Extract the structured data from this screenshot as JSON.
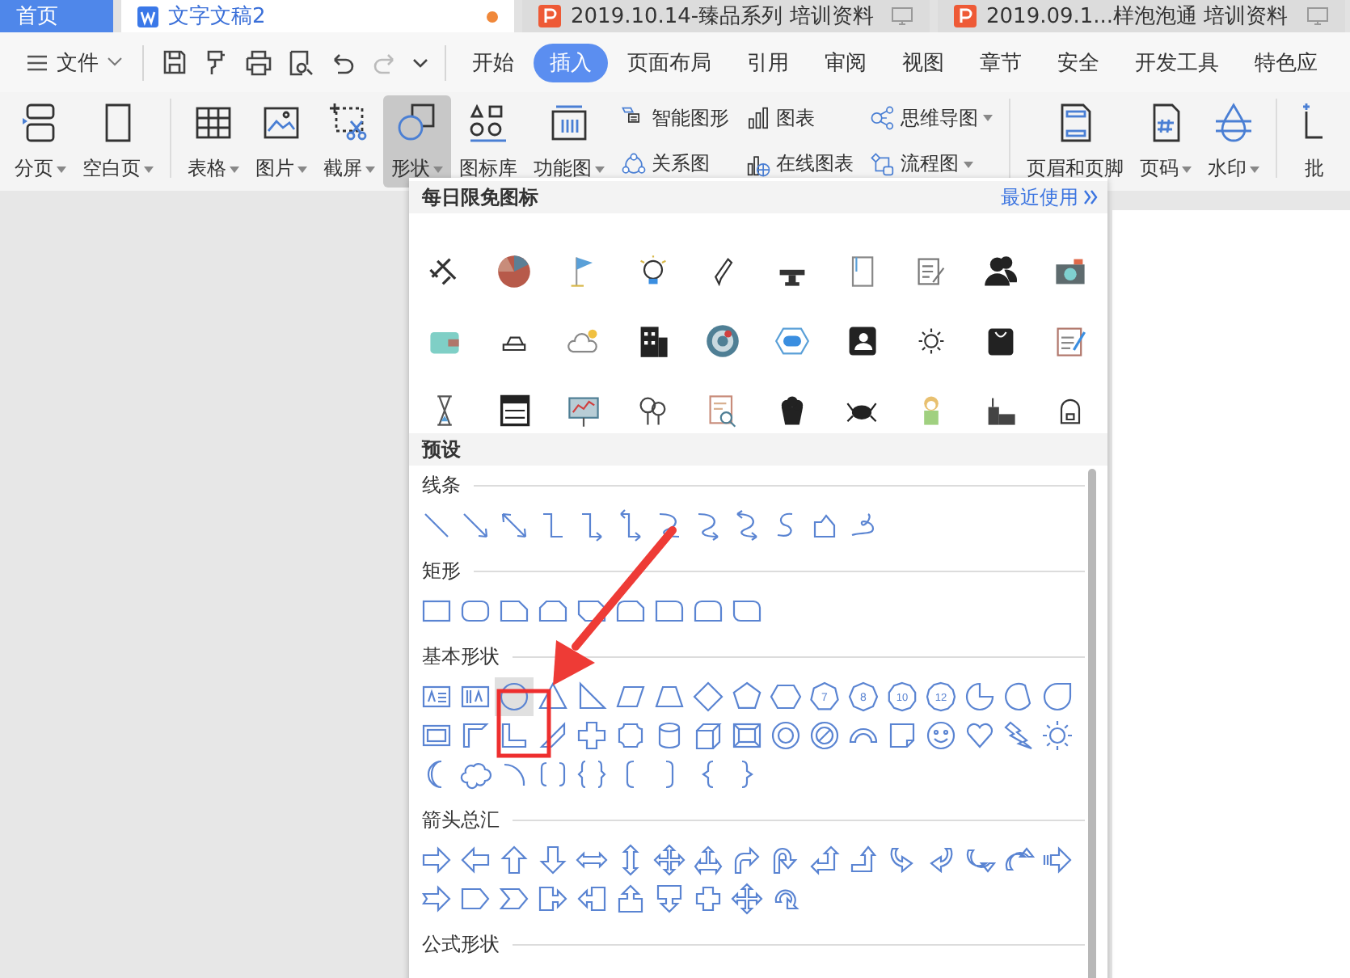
{
  "tabs": [
    {
      "label": "首页",
      "kind": "home",
      "selected": false,
      "modified": false
    },
    {
      "label": "文字文稿2",
      "kind": "writer",
      "selected": true,
      "modified": true
    },
    {
      "label": "2019.10.14-臻品系列 培训资料",
      "kind": "presentation",
      "selected": false,
      "modified": false
    },
    {
      "label": "2019.09.1...样泡泡通 培训资料",
      "kind": "presentation",
      "selected": false,
      "modified": false
    }
  ],
  "file_menu": {
    "label": "文件"
  },
  "menu_tabs": [
    {
      "label": "开始",
      "selected": false
    },
    {
      "label": "插入",
      "selected": true
    },
    {
      "label": "页面布局",
      "selected": false
    },
    {
      "label": "引用",
      "selected": false
    },
    {
      "label": "审阅",
      "selected": false
    },
    {
      "label": "视图",
      "selected": false
    },
    {
      "label": "章节",
      "selected": false
    },
    {
      "label": "安全",
      "selected": false
    },
    {
      "label": "开发工具",
      "selected": false
    },
    {
      "label": "特色应",
      "selected": false
    }
  ],
  "ribbon_groups": [
    [
      {
        "kind": "large",
        "label": "分页",
        "has_menu": true,
        "selected": false
      },
      {
        "kind": "large",
        "label": "空白页",
        "has_menu": true,
        "selected": false
      }
    ],
    [
      {
        "kind": "large",
        "label": "表格",
        "has_menu": true,
        "selected": false
      },
      {
        "kind": "large",
        "label": "图片",
        "has_menu": true,
        "selected": false
      },
      {
        "kind": "large",
        "label": "截屏",
        "has_menu": true,
        "selected": false
      },
      {
        "kind": "large",
        "label": "形状",
        "has_menu": true,
        "selected": true
      },
      {
        "kind": "large",
        "label": "图标库",
        "has_menu": false,
        "selected": false
      },
      {
        "kind": "large",
        "label": "功能图",
        "has_menu": true,
        "selected": false
      },
      {
        "kind": "stack",
        "items": [
          {
            "label": "智能图形",
            "has_menu": false
          },
          {
            "label": "关系图",
            "has_menu": false
          }
        ]
      },
      {
        "kind": "stack",
        "items": [
          {
            "label": "图表",
            "has_menu": false
          },
          {
            "label": "在线图表",
            "has_menu": false
          }
        ]
      },
      {
        "kind": "stack",
        "items": [
          {
            "label": "思维导图",
            "has_menu": true
          },
          {
            "label": "流程图",
            "has_menu": true
          }
        ]
      }
    ],
    [
      {
        "kind": "large",
        "label": "页眉和页脚",
        "has_menu": false,
        "selected": false
      },
      {
        "kind": "large",
        "label": "页码",
        "has_menu": true,
        "selected": false
      },
      {
        "kind": "large",
        "label": "水印",
        "has_menu": true,
        "selected": false
      }
    ],
    [
      {
        "kind": "large",
        "label": "批",
        "has_menu": false,
        "selected": false
      }
    ]
  ],
  "shapes_panel": {
    "icons_title": "每日限免图标",
    "recent_link": "最近使用",
    "preset_title": "预设",
    "sections": [
      {
        "title": "线条",
        "shapes": [
          {
            "kind": "line",
            "selected": false
          },
          {
            "kind": "arrowline",
            "selected": false
          },
          {
            "kind": "doublearrowline",
            "selected": false
          },
          {
            "kind": "elbow",
            "selected": false
          },
          {
            "kind": "elbowarrow",
            "selected": false
          },
          {
            "kind": "elbowdouble",
            "selected": false
          },
          {
            "kind": "curve",
            "selected": false
          },
          {
            "kind": "curvearrow",
            "selected": false
          },
          {
            "kind": "curvedouble",
            "selected": false
          },
          {
            "kind": "freeform",
            "selected": false
          },
          {
            "kind": "scribble",
            "selected": false
          },
          {
            "kind": "loop",
            "selected": false
          }
        ]
      },
      {
        "title": "矩形",
        "shapes": [
          {
            "kind": "rect",
            "selected": false
          },
          {
            "kind": "roundrect",
            "selected": false
          },
          {
            "kind": "snipcorner",
            "selected": false
          },
          {
            "kind": "snipsame",
            "selected": false
          },
          {
            "kind": "snipdiag",
            "selected": false
          },
          {
            "kind": "sniprounded",
            "selected": false
          },
          {
            "kind": "roundcorner",
            "selected": false
          },
          {
            "kind": "roundsame",
            "selected": false
          },
          {
            "kind": "rounddiag",
            "selected": false
          }
        ]
      },
      {
        "title": "基本形状",
        "shapes": [
          {
            "kind": "textbox",
            "selected": false
          },
          {
            "kind": "verticaltextbox",
            "selected": false
          },
          {
            "kind": "ellipse",
            "selected": true
          },
          {
            "kind": "triangle",
            "selected": false
          },
          {
            "kind": "righttriangle",
            "selected": false
          },
          {
            "kind": "parallelogram",
            "selected": false
          },
          {
            "kind": "trapezoid",
            "selected": false
          },
          {
            "kind": "diamond",
            "selected": false
          },
          {
            "kind": "pentagon",
            "selected": false
          },
          {
            "kind": "hexagon",
            "selected": false
          },
          {
            "kind": "heptagon",
            "label": "7",
            "selected": false
          },
          {
            "kind": "octagon",
            "label": "8",
            "selected": false
          },
          {
            "kind": "decagon",
            "label": "10",
            "selected": false
          },
          {
            "kind": "dodecagon",
            "label": "12",
            "selected": false
          },
          {
            "kind": "pie",
            "selected": false
          },
          {
            "kind": "chord",
            "selected": false
          },
          {
            "kind": "teardrop",
            "selected": false
          },
          {
            "kind": "frame",
            "selected": false
          },
          {
            "kind": "halfframe",
            "selected": false
          },
          {
            "kind": "lshape",
            "selected": false
          },
          {
            "kind": "diagstripe",
            "selected": false
          },
          {
            "kind": "cross",
            "selected": false
          },
          {
            "kind": "plaque",
            "selected": false
          },
          {
            "kind": "can",
            "selected": false
          },
          {
            "kind": "cube",
            "selected": false
          },
          {
            "kind": "bevel",
            "selected": false
          },
          {
            "kind": "donut",
            "selected": false
          },
          {
            "kind": "nosymbol",
            "selected": false
          },
          {
            "kind": "blockarc",
            "selected": false
          },
          {
            "kind": "foldedcorner",
            "selected": false
          },
          {
            "kind": "smiley",
            "selected": false
          },
          {
            "kind": "heart",
            "selected": false
          },
          {
            "kind": "lightning",
            "selected": false
          },
          {
            "kind": "sun",
            "selected": false
          },
          {
            "kind": "moon",
            "selected": false
          },
          {
            "kind": "cloud",
            "selected": false
          },
          {
            "kind": "arc",
            "selected": false
          },
          {
            "kind": "bracketpair",
            "selected": false
          },
          {
            "kind": "bracepair",
            "selected": false
          },
          {
            "kind": "leftbracket",
            "selected": false
          },
          {
            "kind": "rightbracket",
            "selected": false
          },
          {
            "kind": "leftbrace",
            "selected": false
          },
          {
            "kind": "rightbrace",
            "selected": false
          }
        ]
      },
      {
        "title": "箭头总汇",
        "shapes": [
          {
            "kind": "rightarrow",
            "selected": false
          },
          {
            "kind": "leftarrow",
            "selected": false
          },
          {
            "kind": "uparrow",
            "selected": false
          },
          {
            "kind": "downarrow",
            "selected": false
          },
          {
            "kind": "leftrightarrow",
            "selected": false
          },
          {
            "kind": "updownarrow",
            "selected": false
          },
          {
            "kind": "quadarrow",
            "selected": false
          },
          {
            "kind": "leftrightuparrow",
            "selected": false
          },
          {
            "kind": "bentarrow",
            "selected": false
          },
          {
            "kind": "uturnarrow",
            "selected": false
          },
          {
            "kind": "leftuparrow",
            "selected": false
          },
          {
            "kind": "bentuparrow",
            "selected": false
          },
          {
            "kind": "curvedright",
            "selected": false
          },
          {
            "kind": "curvedleft",
            "selected": false
          },
          {
            "kind": "curvedup",
            "selected": false
          },
          {
            "kind": "curveddown",
            "selected": false
          },
          {
            "kind": "stripedarrow",
            "selected": false
          },
          {
            "kind": "notchedarrow",
            "selected": false
          },
          {
            "kind": "homeplate",
            "selected": false
          },
          {
            "kind": "chevron",
            "selected": false
          },
          {
            "kind": "rightcallout",
            "selected": false
          },
          {
            "kind": "leftcallout",
            "selected": false
          },
          {
            "kind": "upcallout",
            "selected": false
          },
          {
            "kind": "downcallout",
            "selected": false
          },
          {
            "kind": "crossarrow",
            "selected": false
          },
          {
            "kind": "quadcallout",
            "selected": false
          },
          {
            "kind": "circulararrow",
            "selected": false
          }
        ]
      },
      {
        "title": "公式形状"
      }
    ]
  }
}
